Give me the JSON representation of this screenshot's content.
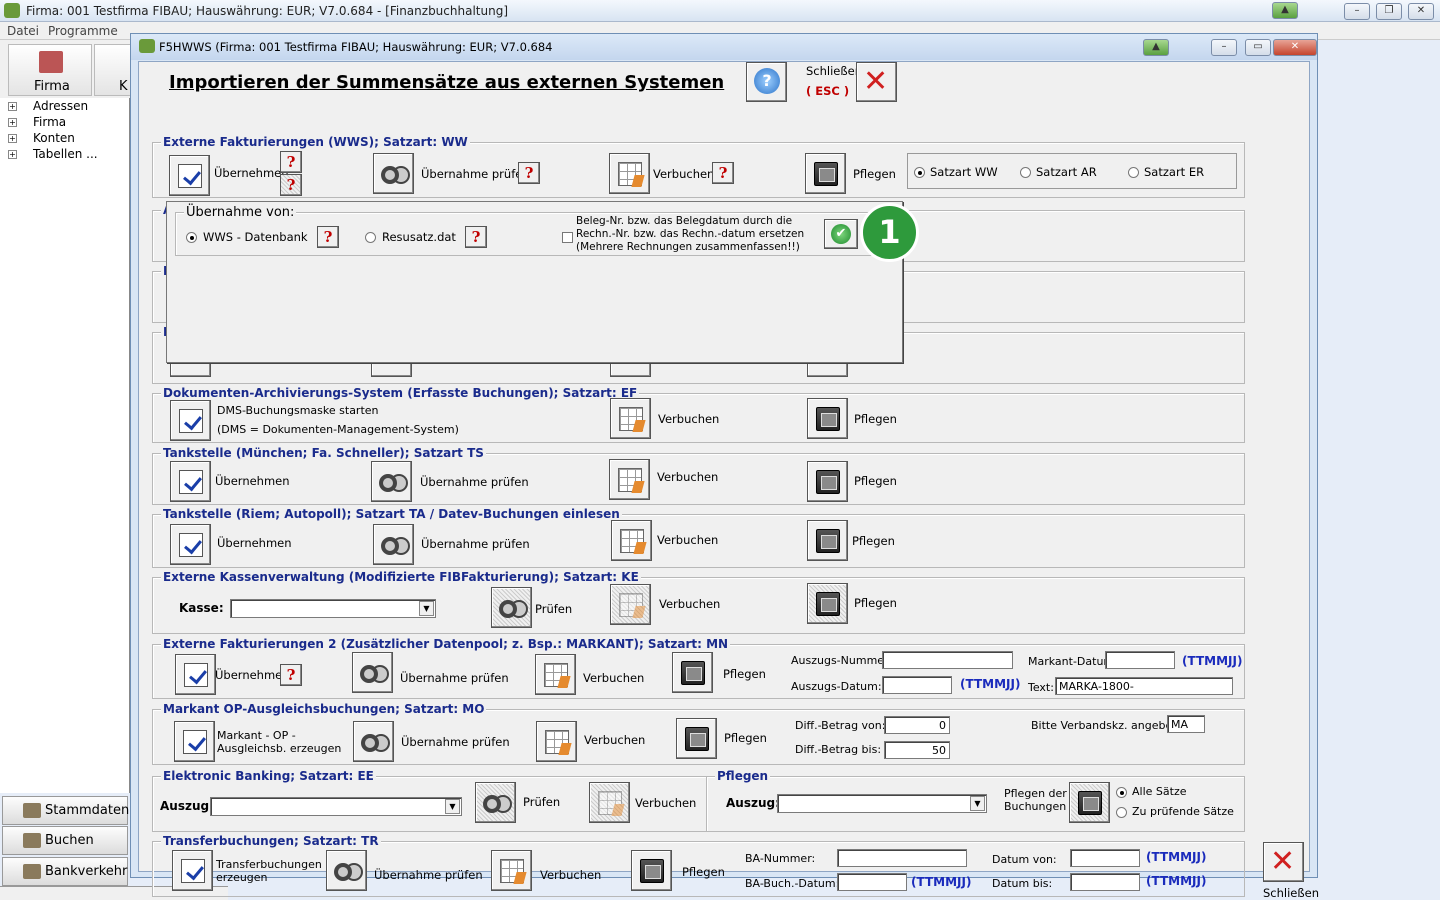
{
  "main_window": {
    "title": "Firma: 001 Testfirma FIBAU;   Hauswährung: EUR; V7.0.684  - [Finanzbuchhaltung]",
    "menu": [
      "Datei",
      "Programme"
    ]
  },
  "toolbar": {
    "firma": "Firma",
    "next": "K"
  },
  "tree": [
    "Adressen",
    "Firma",
    "Konten",
    "Tabellen ..."
  ],
  "nav": [
    "Stammdaten",
    "Buchen",
    "Bankverkehr"
  ],
  "dialog": {
    "title": "F5HWWS  (Firma: 001 Testfirma FIBAU;   Hauswährung: EUR; V7.0.684",
    "heading": "Importieren der Summensätze aus externen Systemen",
    "close_label": "Schließen",
    "esc_label": "( ESC )",
    "bottom_close": "Schließen"
  },
  "labels": {
    "uebernehmen": "Übernehmen",
    "uebernahme_pruefen": "Übernahme prüfen",
    "verbuchen": "Verbuchen",
    "pflegen": "Pflegen",
    "pruefen": "Prüfen",
    "q": "?"
  },
  "wws": {
    "legend": "Externe Fakturierungen (WWS); Satzart: WW",
    "radios": [
      "Satzart WW",
      "Satzart AR",
      "Satzart ER"
    ]
  },
  "popup": {
    "legend": "Übernahme von:",
    "opt1": "WWS - Datenbank",
    "opt2": "Resusatz.dat",
    "check_text": "Beleg-Nr. bzw. das Belegdatum durch die\nRechn.-Nr. bzw. das Rechn.-datum ersetzen\n(Mehrere Rechnungen zusammenfassen!!)",
    "badge": "1"
  },
  "dms": {
    "legend": "Dokumenten-Archivierungs-System (Erfasste Buchungen); Satzart: EF",
    "line1": "DMS-Buchungsmaske starten",
    "line2": "(DMS = Dokumenten-Management-System)"
  },
  "ts": {
    "legend": "Tankstelle (München; Fa. Schneller); Satzart TS"
  },
  "ta": {
    "legend": "Tankstelle (Riem; Autopoll); Satzart TA / Datev-Buchungen einlesen"
  },
  "ke": {
    "legend": "Externe Kassenverwaltung (Modifizierte FIBFakturierung); Satzart: KE",
    "kasse": "Kasse:"
  },
  "mn": {
    "legend": "Externe Fakturierungen 2  (Zusätzlicher Datenpool; z. Bsp.:  MARKANT); Satzart: MN",
    "auszugsnr": "Auszugs-Nummer:",
    "auszugsdatum": "Auszugs-Datum:",
    "markantdatum": "Markant-Datum:",
    "text": "Text:",
    "text_value": "MARKA-1800-",
    "fmt": "(TTMMJJ)"
  },
  "mo": {
    "legend": "Markant OP-Ausgleichsbuchungen; Satzart: MO",
    "btn": "Markant - OP -\nAusgleichsb. erzeugen",
    "diff_von": "Diff.-Betrag von:",
    "diff_von_val": "0",
    "diff_bis": "Diff.-Betrag bis:",
    "diff_bis_val": "50",
    "verband": "Bitte Verbandskz. angeben:",
    "verband_val": "MA"
  },
  "ee": {
    "legend": "Elektronic Banking; Satzart: EE",
    "auszug": "Auszug:"
  },
  "pfl": {
    "legend": "Pflegen",
    "auszug": "Auszug:",
    "btn": "Pflegen der\nBuchungen",
    "r1": "Alle Sätze",
    "r2": "Zu prüfende Sätze"
  },
  "tr": {
    "legend": "Transferbuchungen; Satzart: TR",
    "btn": "Transferbuchungen\nerzeugen",
    "banr": "BA-Nummer:",
    "babuch": "BA-Buch.-Datum:",
    "dvon": "Datum von:",
    "dbis": "Datum bis:",
    "fmt": "(TTMMJJ)"
  },
  "colors": {
    "legend": "#1a2b8c",
    "accent": "#1a2bbc",
    "badge": "#2e9a3c"
  }
}
